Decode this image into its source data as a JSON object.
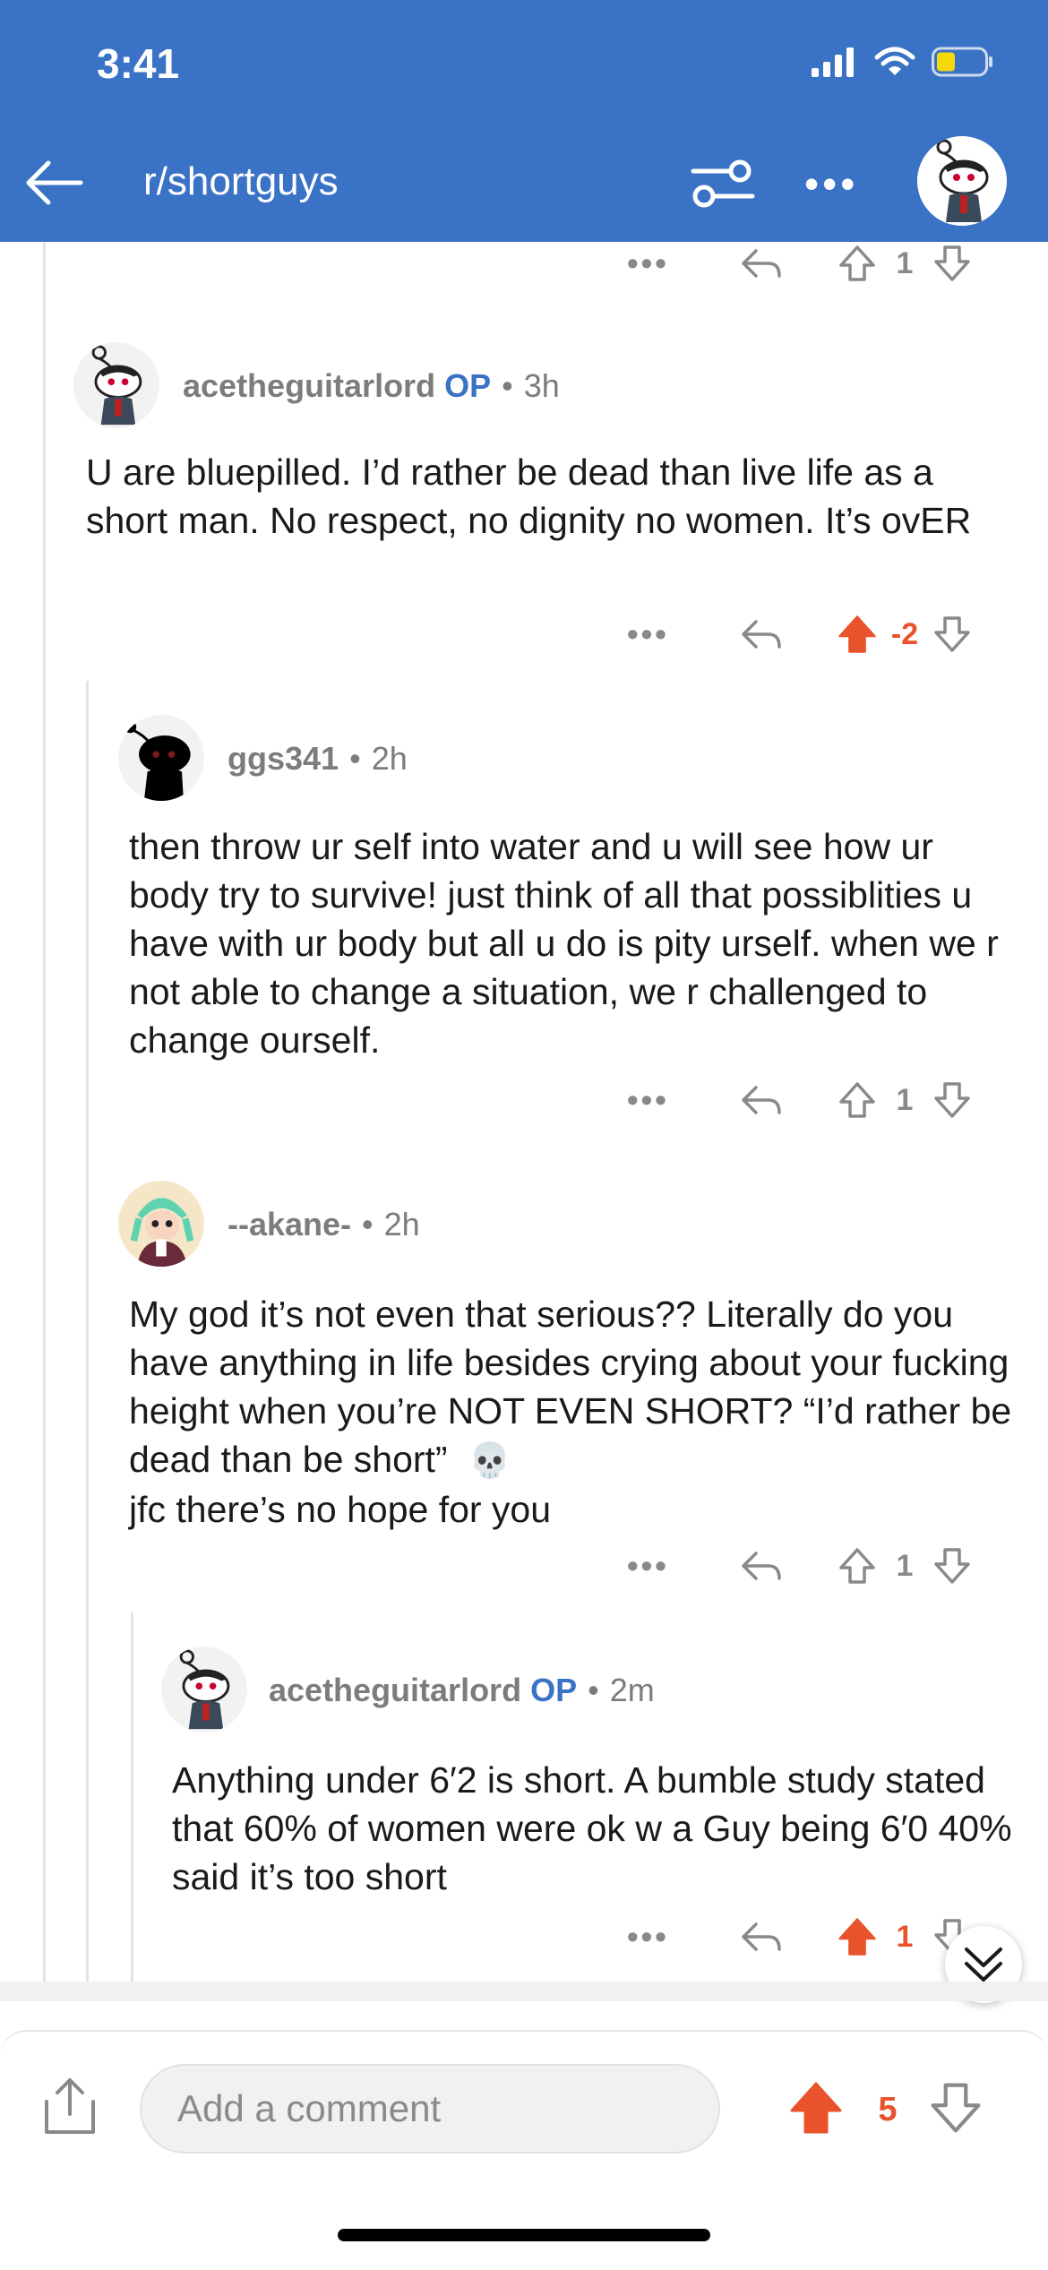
{
  "status": {
    "time": "3:41"
  },
  "header": {
    "subreddit": "r/shortguys",
    "more": "•••"
  },
  "top_actions": {
    "dots": "•••",
    "score": "1"
  },
  "comments": [
    {
      "user": "acetheguitarlord",
      "op": "OP",
      "time": "3h",
      "body": "U are bluepilled. I’d rather be dead than live life as a short man. No respect, no dignity no women. It’s ovER",
      "score": "-2",
      "dots": "•••"
    },
    {
      "user": "ggs341",
      "time": "2h",
      "body": "then throw ur self into water and u will see how ur body try to survive! just think of all that possiblities u have with ur body but all u do is pity urself. when we r not able to change a situation, we r challenged to change ourself.",
      "score": "1",
      "dots": "•••"
    },
    {
      "user": "--akane-",
      "time": "2h",
      "body": "My god it’s not even that serious?? Literally do you have anything in life besides crying about your fucking height when you’re NOT EVEN SHORT? “I’d rather be dead than be short”",
      "body_end": "jfc there’s no hope for you",
      "emoji": "💀",
      "score": "1",
      "dots": "•••"
    },
    {
      "user": "acetheguitarlord",
      "op": "OP",
      "time": "2m",
      "body": "Anything under 6′2 is short. A bumble study stated that 60% of women were ok w a Guy being 6′0 40% said it’s too short",
      "score": "1",
      "dots": "•••"
    }
  ],
  "bottom": {
    "placeholder": "Add a comment",
    "post_score": "5"
  },
  "colors": {
    "header": "#3a72c6",
    "upvote": "#e8532b",
    "op": "#3a72c6"
  }
}
